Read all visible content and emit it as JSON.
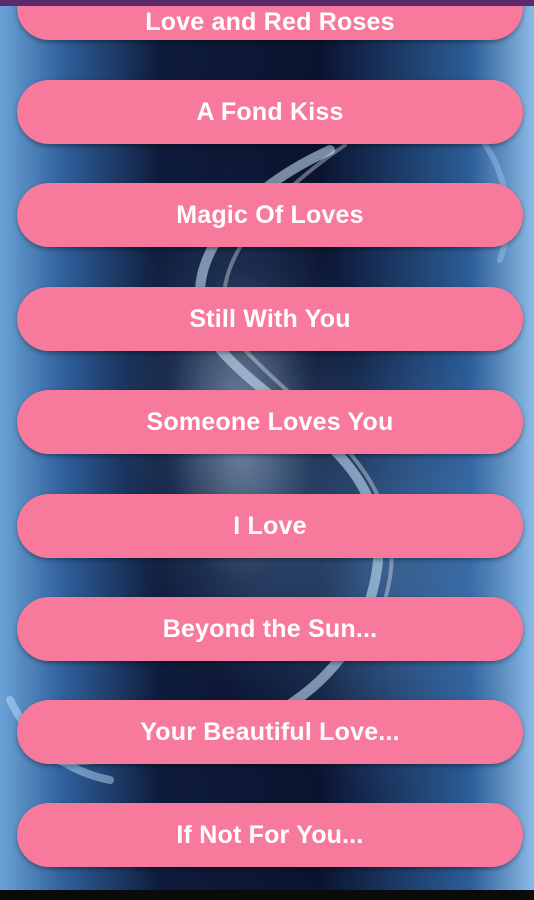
{
  "background": {
    "description_icon": "water-heart-background",
    "accent": "#f77a9c"
  },
  "songs": [
    {
      "label": "Love and Red Roses"
    },
    {
      "label": "A Fond Kiss"
    },
    {
      "label": "Magic Of Loves"
    },
    {
      "label": "Still With You"
    },
    {
      "label": "Someone Loves You"
    },
    {
      "label": "I Love"
    },
    {
      "label": "Beyond the Sun..."
    },
    {
      "label": "Your Beautiful Love..."
    },
    {
      "label": "If Not For You..."
    }
  ]
}
